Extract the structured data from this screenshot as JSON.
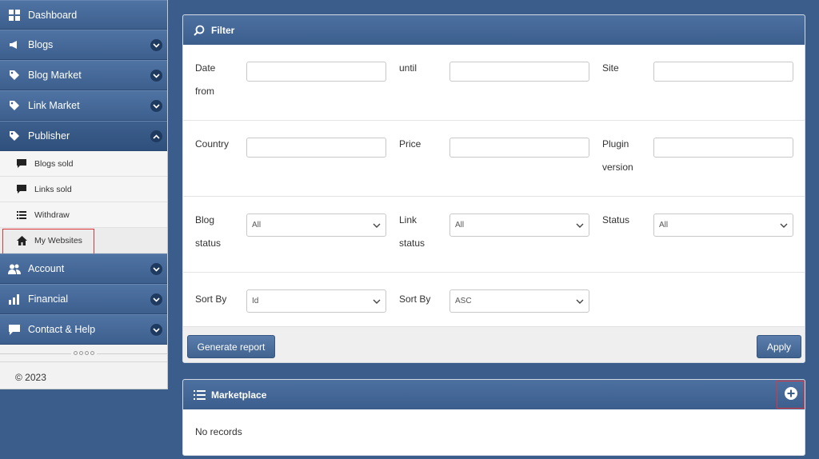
{
  "sidebar": {
    "items": [
      {
        "label": "Dashboard",
        "icon": "grid-icon"
      },
      {
        "label": "Blogs",
        "icon": "megaphone-icon"
      },
      {
        "label": "Blog Market",
        "icon": "tag-icon"
      },
      {
        "label": "Link Market",
        "icon": "tag-icon"
      },
      {
        "label": "Publisher",
        "icon": "tag-icon"
      },
      {
        "label": "Account",
        "icon": "users-icon"
      },
      {
        "label": "Financial",
        "icon": "bar-chart-icon"
      },
      {
        "label": "Contact & Help",
        "icon": "chat-icon"
      }
    ],
    "publisher_sub": [
      {
        "label": "Blogs sold",
        "icon": "comment-icon"
      },
      {
        "label": "Links sold",
        "icon": "comment-icon"
      },
      {
        "label": "Withdraw",
        "icon": "list-icon"
      },
      {
        "label": "My Websites",
        "icon": "home-icon"
      }
    ],
    "copyright": "© 2023"
  },
  "filter": {
    "title": "Filter",
    "fields": {
      "date_from": "Date from",
      "until": "until",
      "site": "Site",
      "country": "Country",
      "price": "Price",
      "plugin_version": "Plugin version",
      "blog_status": "Blog status",
      "link_status": "Link status",
      "status": "Status",
      "sort_by_1": "Sort By",
      "sort_by_2": "Sort By"
    },
    "selects": {
      "blog_status": "All",
      "link_status": "All",
      "status": "All",
      "sort_by_1": "Id",
      "sort_by_2": "ASC"
    },
    "generate_report": "Generate report",
    "apply": "Apply"
  },
  "marketplace": {
    "title": "Marketplace",
    "empty": "No records"
  },
  "colors": {
    "background": "#3a5d8c",
    "header": "#3b5e8d",
    "highlight": "#e0353a"
  }
}
